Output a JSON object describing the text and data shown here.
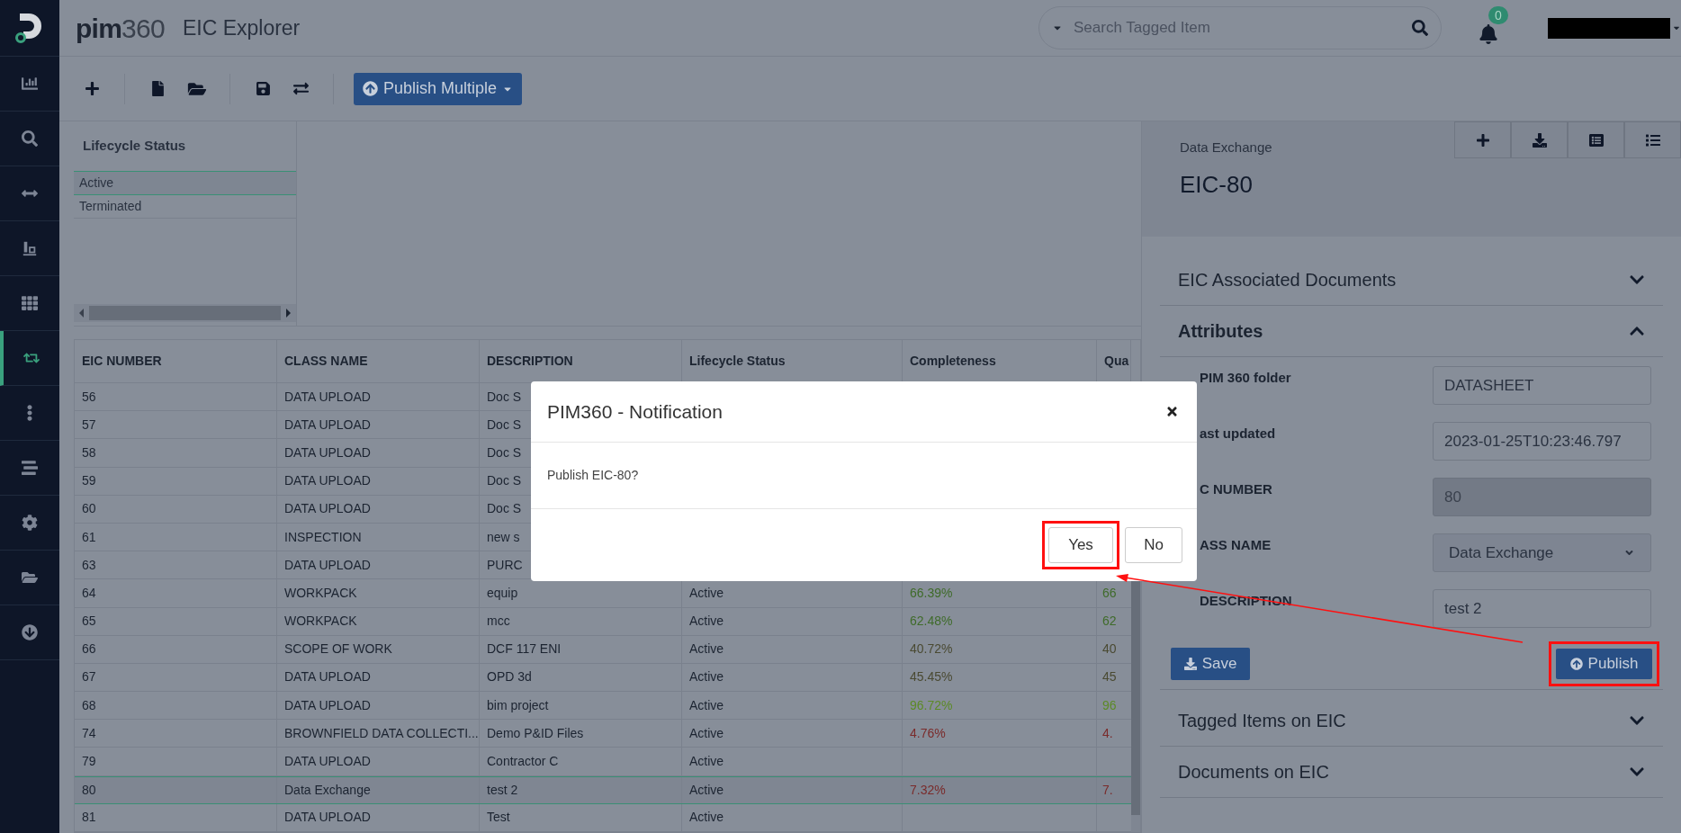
{
  "header": {
    "logo_bold": "pim",
    "logo_light": "360",
    "title": "EIC Explorer",
    "search": {
      "placeholder": "Search Tagged Item"
    },
    "notifications": {
      "count": "0"
    }
  },
  "sidebar": {
    "items": [
      {
        "selected": false
      },
      {
        "selected": false
      },
      {
        "selected": false
      },
      {
        "selected": false
      },
      {
        "selected": false
      },
      {
        "selected": true
      },
      {
        "selected": false
      },
      {
        "selected": false
      },
      {
        "selected": false
      },
      {
        "selected": false
      },
      {
        "selected": false
      }
    ]
  },
  "toolbar": {
    "publish_multiple": "Publish Multiple"
  },
  "lifecycle_filter": {
    "heading": "Lifecycle Status",
    "items": [
      {
        "label": "Active",
        "selected": true
      },
      {
        "label": "Terminated",
        "selected": false
      }
    ]
  },
  "table": {
    "columns": [
      "EIC NUMBER",
      "CLASS NAME",
      "DESCRIPTION",
      "Lifecycle Status",
      "Completeness",
      "Qua"
    ],
    "rows": [
      {
        "eic_number": "56",
        "class_name": "DATA UPLOAD",
        "description": "Doc S",
        "selected": false
      },
      {
        "eic_number": "57",
        "class_name": "DATA UPLOAD",
        "description": "Doc S",
        "selected": false
      },
      {
        "eic_number": "58",
        "class_name": "DATA UPLOAD",
        "description": "Doc S",
        "selected": false
      },
      {
        "eic_number": "59",
        "class_name": "DATA UPLOAD",
        "description": "Doc S",
        "selected": false
      },
      {
        "eic_number": "60",
        "class_name": "DATA UPLOAD",
        "description": "Doc S",
        "selected": false
      },
      {
        "eic_number": "61",
        "class_name": "INSPECTION",
        "description": "new s",
        "selected": false
      },
      {
        "eic_number": "63",
        "class_name": "DATA UPLOAD",
        "description": "PURC",
        "selected": false
      },
      {
        "eic_number": "64",
        "class_name": "WORKPACK",
        "description": "equip",
        "lifecycle_status": "Active",
        "completeness": {
          "text": "66.39%",
          "color": "#3f6b2a"
        },
        "quality": {
          "text": "66",
          "color": "#3f6b2a"
        },
        "selected": false
      },
      {
        "eic_number": "65",
        "class_name": "WORKPACK",
        "description": "mcc",
        "lifecycle_status": "Active",
        "completeness": {
          "text": "62.48%",
          "color": "#3f6b2a"
        },
        "quality": {
          "text": "62",
          "color": "#3f6b2a"
        },
        "selected": false
      },
      {
        "eic_number": "66",
        "class_name": "SCOPE OF WORK",
        "description": "DCF 117 ENI",
        "lifecycle_status": "Active",
        "completeness": {
          "text": "40.72%",
          "color": "#4a4a32"
        },
        "quality": {
          "text": "40",
          "color": "#4a4a32"
        },
        "selected": false
      },
      {
        "eic_number": "67",
        "class_name": "DATA UPLOAD",
        "description": "OPD 3d",
        "lifecycle_status": "Active",
        "completeness": {
          "text": "45.45%",
          "color": "#4a4a32"
        },
        "quality": {
          "text": "45",
          "color": "#4a4a32"
        },
        "selected": false
      },
      {
        "eic_number": "68",
        "class_name": "DATA UPLOAD",
        "description": "bim project",
        "lifecycle_status": "Active",
        "completeness": {
          "text": "96.72%",
          "color": "#5c8a26"
        },
        "quality": {
          "text": "96",
          "color": "#5c8a26"
        },
        "selected": false
      },
      {
        "eic_number": "74",
        "class_name": "BROWNFIELD DATA COLLECTI...",
        "description": "Demo P&ID Files",
        "lifecycle_status": "Active",
        "completeness": {
          "text": "4.76%",
          "color": "#7a2b2b"
        },
        "quality": {
          "text": "4.",
          "color": "#7a2b2b"
        },
        "selected": false
      },
      {
        "eic_number": "79",
        "class_name": "DATA UPLOAD",
        "description": "Contractor C",
        "lifecycle_status": "Active",
        "selected": false
      },
      {
        "eic_number": "80",
        "class_name": "Data Exchange",
        "description": "test 2",
        "lifecycle_status": "Active",
        "completeness": {
          "text": "7.32%",
          "color": "#7a2b2b"
        },
        "quality": {
          "text": "7.",
          "color": "#7a2b2b"
        },
        "selected": true
      },
      {
        "eic_number": "81",
        "class_name": "DATA UPLOAD",
        "description": "Test",
        "lifecycle_status": "Active",
        "selected": false
      }
    ]
  },
  "detail": {
    "subtitle": "Data Exchange",
    "title": "EIC-80",
    "sections_before": [
      {
        "title": "EIC Associated Documents",
        "expanded": false
      },
      {
        "title": "Attributes",
        "expanded": true
      }
    ],
    "fields": [
      {
        "label": "PIM 360 folder",
        "value": "DATASHEET",
        "kind": "input",
        "disabled": false
      },
      {
        "label": "ast updated",
        "value": "2023-01-25T10:23:46.797",
        "kind": "input",
        "disabled": false
      },
      {
        "label": "C NUMBER",
        "value": "80",
        "kind": "input",
        "disabled": true
      },
      {
        "label": "ASS NAME",
        "value": "Data Exchange",
        "kind": "select",
        "disabled": false
      },
      {
        "label": "DESCRIPTION",
        "value": "test 2",
        "kind": "input",
        "disabled": false
      }
    ],
    "save": "Save",
    "publish": "Publish",
    "sections_after": [
      {
        "title": "Tagged Items on EIC",
        "expanded": false
      },
      {
        "title": "Documents on EIC",
        "expanded": false
      }
    ]
  },
  "dialog": {
    "title": "PIM360 - Notification",
    "message": "Publish EIC-80?",
    "buttons": [
      "Yes",
      "No"
    ]
  }
}
